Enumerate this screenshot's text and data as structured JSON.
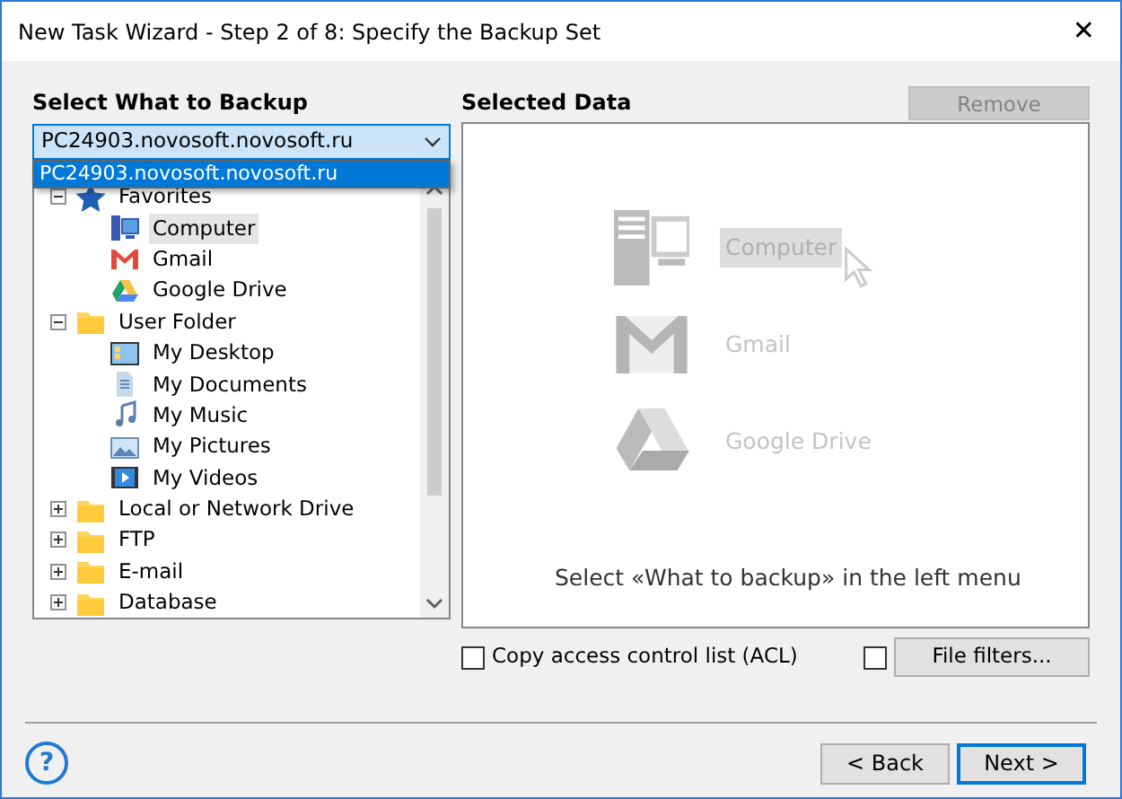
{
  "window": {
    "title": "New Task Wizard - Step 2 of 8: Specify the Backup Set",
    "close": "✕"
  },
  "left": {
    "heading": "Select What to Backup",
    "source": {
      "value": "PC24903.novosoft.novosoft.ru",
      "expanded": true,
      "options": [
        {
          "label": "PC24903.novosoft.novosoft.ru",
          "selected": true
        }
      ]
    },
    "tree": [
      {
        "label": "Favorites",
        "kind": "star",
        "expanded": true,
        "selected": false,
        "children": [
          {
            "label": "Computer",
            "kind": "computer",
            "selected": true
          },
          {
            "label": "Gmail",
            "kind": "gmail",
            "selected": false
          },
          {
            "label": "Google Drive",
            "kind": "drive",
            "selected": false
          }
        ]
      },
      {
        "label": "User Folder",
        "kind": "folder",
        "expanded": true,
        "selected": false,
        "children": [
          {
            "label": "My Desktop",
            "kind": "desktop",
            "selected": false
          },
          {
            "label": "My Documents",
            "kind": "documents",
            "selected": false
          },
          {
            "label": "My Music",
            "kind": "music",
            "selected": false
          },
          {
            "label": "My Pictures",
            "kind": "pictures",
            "selected": false
          },
          {
            "label": "My Videos",
            "kind": "videos",
            "selected": false
          }
        ]
      },
      {
        "label": "Local or Network Drive",
        "kind": "folder",
        "expanded": false,
        "selected": false
      },
      {
        "label": "FTP",
        "kind": "folder",
        "expanded": false,
        "selected": false
      },
      {
        "label": "E-mail",
        "kind": "folder",
        "expanded": false,
        "selected": false
      },
      {
        "label": "Database",
        "kind": "folder",
        "expanded": false,
        "selected": false
      }
    ]
  },
  "right": {
    "heading": "Selected Data",
    "remove": {
      "label": "Remove",
      "disabled": true
    },
    "examples": [
      {
        "label": "Computer",
        "kind": "computer",
        "highlighted": true
      },
      {
        "label": "Gmail",
        "kind": "gmail",
        "highlighted": false
      },
      {
        "label": "Google Drive",
        "kind": "drive",
        "highlighted": false
      }
    ],
    "hint": "Select «What to backup» in the left menu",
    "acl": {
      "label": "Copy access control list (ACL)",
      "checked": false
    },
    "filters": {
      "checked": false,
      "label": "File filters..."
    }
  },
  "footer": {
    "help": "?",
    "buttons": [
      {
        "label": "< Back",
        "default": false
      },
      {
        "label": "Next >",
        "default": true
      }
    ]
  }
}
